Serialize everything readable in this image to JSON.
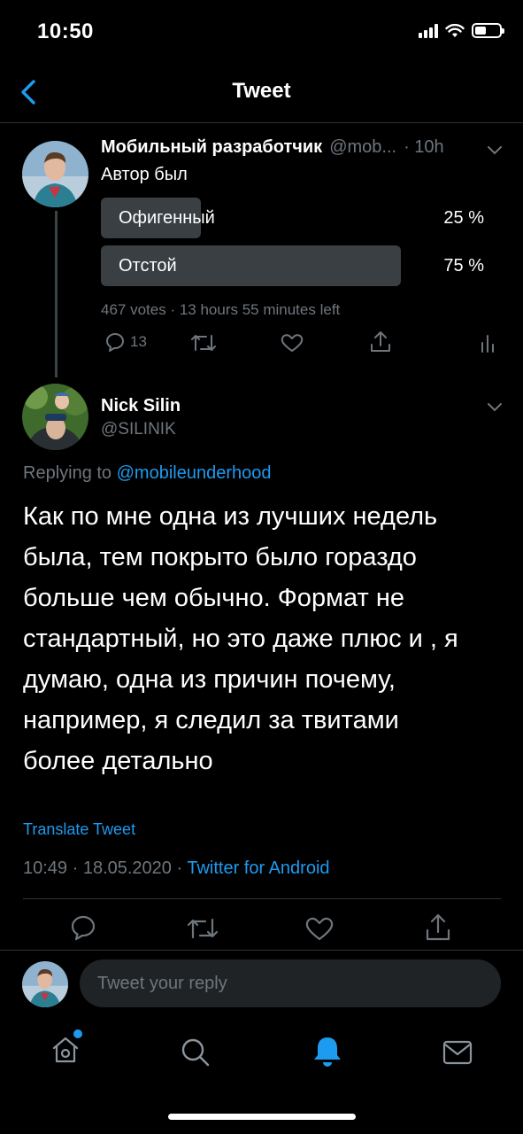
{
  "status_bar": {
    "time": "10:50"
  },
  "header": {
    "title": "Tweet"
  },
  "parent_tweet": {
    "author_name": "Мобильный разработчик",
    "author_handle": "@mob...",
    "time_ago": "· 10h",
    "text": "Автор был",
    "poll": {
      "options": [
        {
          "label": "Офигенный",
          "percent": "25 %",
          "fraction": 0.25
        },
        {
          "label": "Отстой",
          "percent": "75 %",
          "fraction": 0.75
        }
      ],
      "meta": "467 votes · 13 hours 55 minutes left"
    },
    "actions": {
      "reply_count": "13"
    }
  },
  "main_tweet": {
    "author_name": "Nick Silin",
    "author_handle": "@SILINIK",
    "replying_prefix": "Replying to",
    "replying_handle": "@mobileunderhood",
    "text_lines": [
      "Как по мне одна из лучших недель",
      "была, тем покрыто было гораздо",
      "больше чем обычно. Формат не",
      "стандартный, но это даже плюс и , я",
      "думаю, одна из причин почему,",
      "например, я следил за твитами",
      "более детально"
    ],
    "translate": "Translate Tweet",
    "timestamp": "10:49 · 18.05.2020 ·",
    "source": "Twitter for Android"
  },
  "reply_composer": {
    "placeholder": "Tweet your reply"
  },
  "colors": {
    "accent": "#1d9bf0",
    "background": "#000000",
    "muted": "#6e767d",
    "poll_bar": "#3a3f43"
  }
}
